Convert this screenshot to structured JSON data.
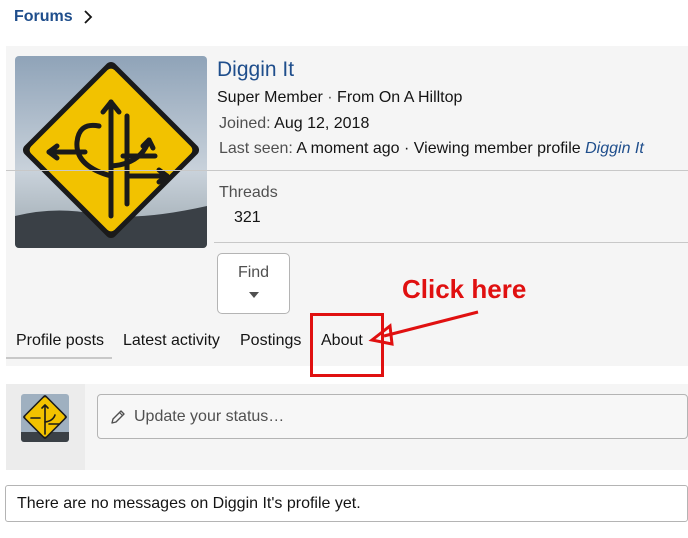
{
  "breadcrumb": {
    "label": "Forums"
  },
  "profile": {
    "name": "Diggin It",
    "title": "Super Member",
    "separator": " · ",
    "location": "From On A Hilltop",
    "joined_label": "Joined:",
    "joined_value": "Aug 12, 2018",
    "last_seen_label": "Last seen:",
    "last_seen_value": "A moment ago · Viewing member profile",
    "last_seen_link": "Diggin It",
    "threads_label": "Threads",
    "threads_count": "321",
    "find_label": "Find"
  },
  "tabs": [
    {
      "label": "Profile posts",
      "active": true
    },
    {
      "label": "Latest activity",
      "active": false
    },
    {
      "label": "Postings",
      "active": false
    },
    {
      "label": "About",
      "active": false
    }
  ],
  "annotation": {
    "text": "Click here",
    "color": "#e01010"
  },
  "status": {
    "placeholder": "Update your status…"
  },
  "messages": {
    "empty_text": "There are no messages on Diggin It's profile yet."
  },
  "colors": {
    "link": "#1f4e8c",
    "sign_yellow": "#f2c200",
    "panel": "#f5f5f5"
  },
  "icons": {
    "breadcrumb": "chevron-right-icon",
    "find": "caret-down-icon",
    "status": "pencil-icon"
  }
}
